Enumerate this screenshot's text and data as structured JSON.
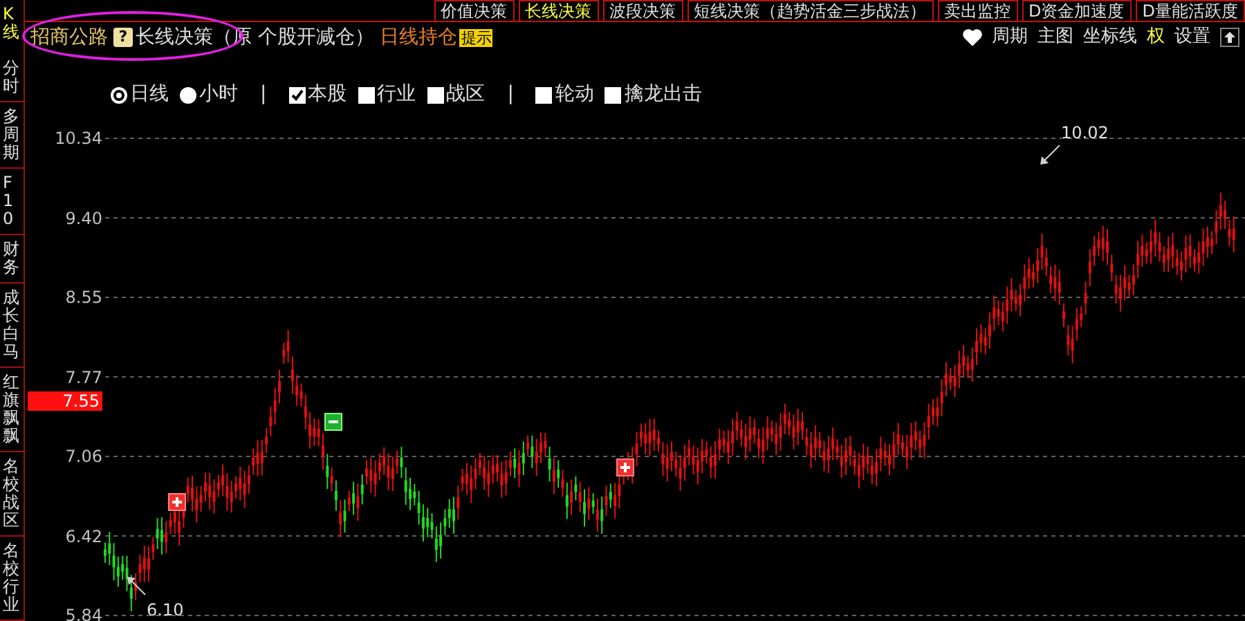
{
  "top_tabs": [
    {
      "label": "价值决策",
      "selected": false
    },
    {
      "label": "长线决策",
      "selected": true
    },
    {
      "label": "波段决策",
      "selected": false
    },
    {
      "label": "短线决策（趋势活金三步战法）",
      "selected": false
    },
    {
      "label": "卖出监控",
      "selected": false
    },
    {
      "label": "D资金加速度",
      "selected": false
    },
    {
      "label": "D量能活跃度",
      "selected": false
    }
  ],
  "sidebar": {
    "items": [
      {
        "label": "K线",
        "selected": true
      },
      {
        "label": "分时",
        "selected": false
      },
      {
        "label": "多周期",
        "selected": false
      },
      {
        "label": "F10",
        "selected": false
      },
      {
        "label": "财务",
        "selected": false
      },
      {
        "label": "成长白马",
        "selected": false
      },
      {
        "label": "红旗飘飘",
        "selected": false
      },
      {
        "label": "名校战区",
        "selected": false
      },
      {
        "label": "名校行业",
        "selected": false
      }
    ]
  },
  "header": {
    "stock_name": "招商公路",
    "help_icon": "?",
    "strategy": "长线决策（原 个股开减仓）",
    "position": "日线持仓",
    "hint_badge": "提示"
  },
  "toolbar": {
    "items": [
      {
        "label": "周期",
        "highlighted": false
      },
      {
        "label": "主图",
        "highlighted": false
      },
      {
        "label": "坐标线",
        "highlighted": false
      },
      {
        "label": "权",
        "highlighted": true
      },
      {
        "label": "设置",
        "highlighted": false
      }
    ]
  },
  "options": [
    {
      "kind": "radio",
      "label": "日线",
      "selected": true
    },
    {
      "kind": "radio",
      "label": "小时",
      "selected": false
    },
    {
      "kind": "separator",
      "label": "|"
    },
    {
      "kind": "checkbox",
      "label": "本股",
      "checked": true
    },
    {
      "kind": "checkbox",
      "label": "行业",
      "checked": false
    },
    {
      "kind": "checkbox",
      "label": "战区",
      "checked": false
    },
    {
      "kind": "separator",
      "label": "|"
    },
    {
      "kind": "checkbox",
      "label": "轮动",
      "checked": false
    },
    {
      "kind": "checkbox",
      "label": "擒龙出击",
      "checked": false
    }
  ],
  "chart": {
    "y_ticks": [
      "10.34",
      "9.40",
      "8.55",
      "7.77",
      "7.06",
      "6.42",
      "5.84"
    ],
    "current_price": "7.55",
    "high_label": "10.02",
    "low_label": "6.10",
    "signals": [
      {
        "kind": "buy"
      },
      {
        "kind": "sell"
      },
      {
        "kind": "buy"
      }
    ]
  }
}
